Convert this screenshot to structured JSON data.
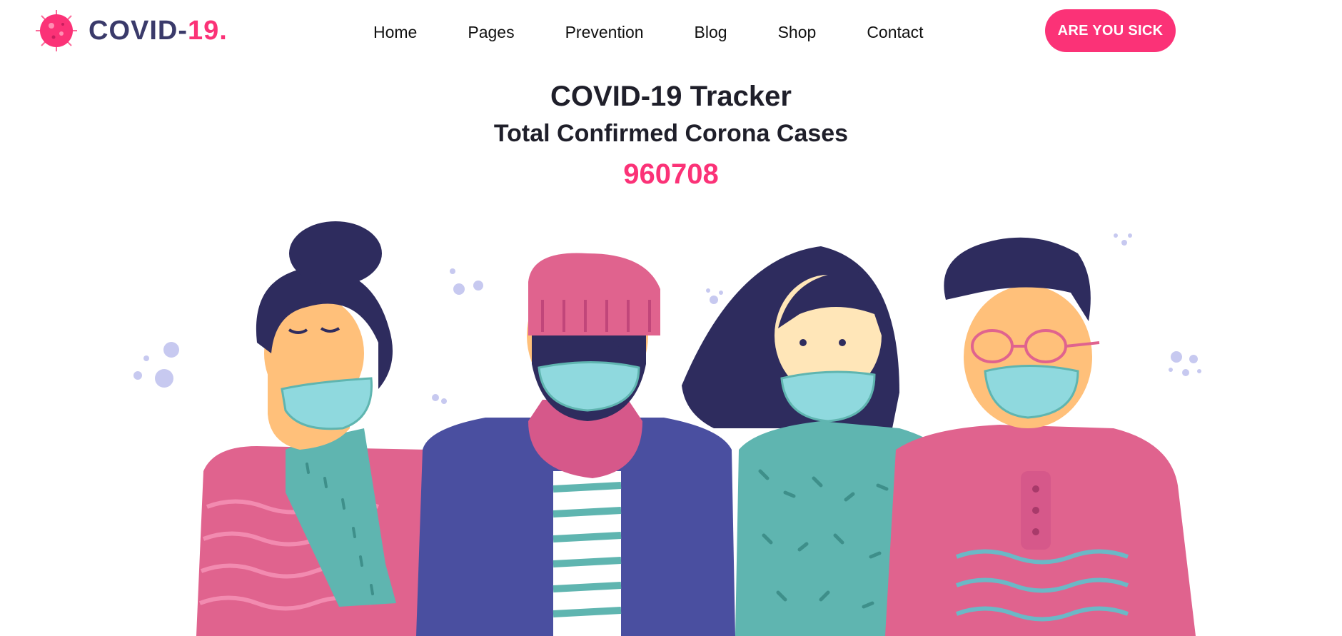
{
  "brand": {
    "name_main": "COVID-",
    "name_accent": "19.",
    "primary_color": "#fb3277",
    "text_color": "#3a3a6a"
  },
  "nav": {
    "items": [
      "Home",
      "Pages",
      "Prevention",
      "Blog",
      "Shop",
      "Contact"
    ]
  },
  "cta": {
    "label": "ARE YOU SICK"
  },
  "tracker": {
    "title": "COVID-19 Tracker",
    "subtitle": "Total Confirmed Corona Cases",
    "count": "960708"
  },
  "illustration": {
    "subject": "four people wearing face masks"
  }
}
